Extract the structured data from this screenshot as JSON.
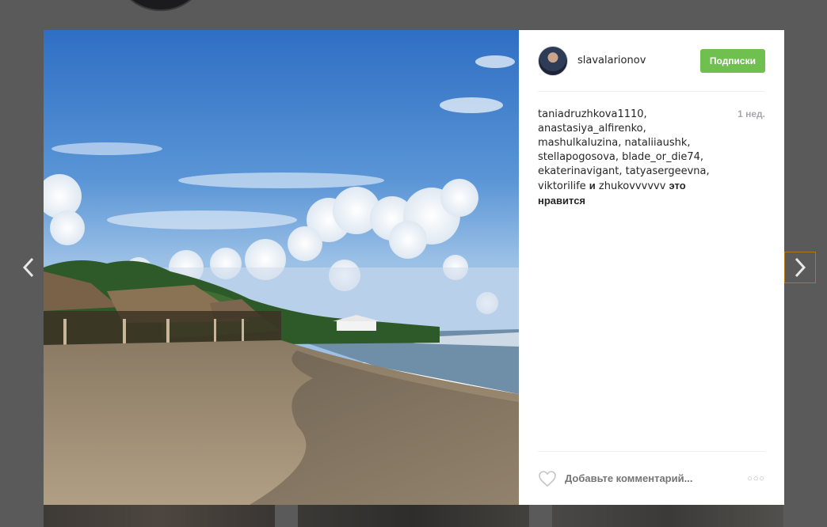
{
  "post": {
    "username": "slavalarionov",
    "follow_label": "Подписки",
    "timestamp": "1 нед.",
    "likes": {
      "line1": "taniadruzhkova1110,",
      "line2": "anastasiya_alfirenko,",
      "line3": "mashulkaluzina, nataliiaushk,",
      "line4": "stellapogosova, blade_or_die74,",
      "line5": "ekaterinavigant, tatyasergeevna,",
      "line6_user": "viktorilife",
      "and": "и",
      "line6_user2": "zhukovvvvvv",
      "tail": "это нравится"
    },
    "comment_placeholder": "Добавьте комментарий...",
    "more_label": "○○○"
  },
  "icons": {
    "prev": "chevron-left-icon",
    "next": "chevron-right-icon",
    "like": "heart-outline-icon",
    "more": "more-dots-icon"
  },
  "colors": {
    "follow_button": "#70c050",
    "next_arrow_border": "#b07a12",
    "backdrop": "#5a5a5a"
  }
}
